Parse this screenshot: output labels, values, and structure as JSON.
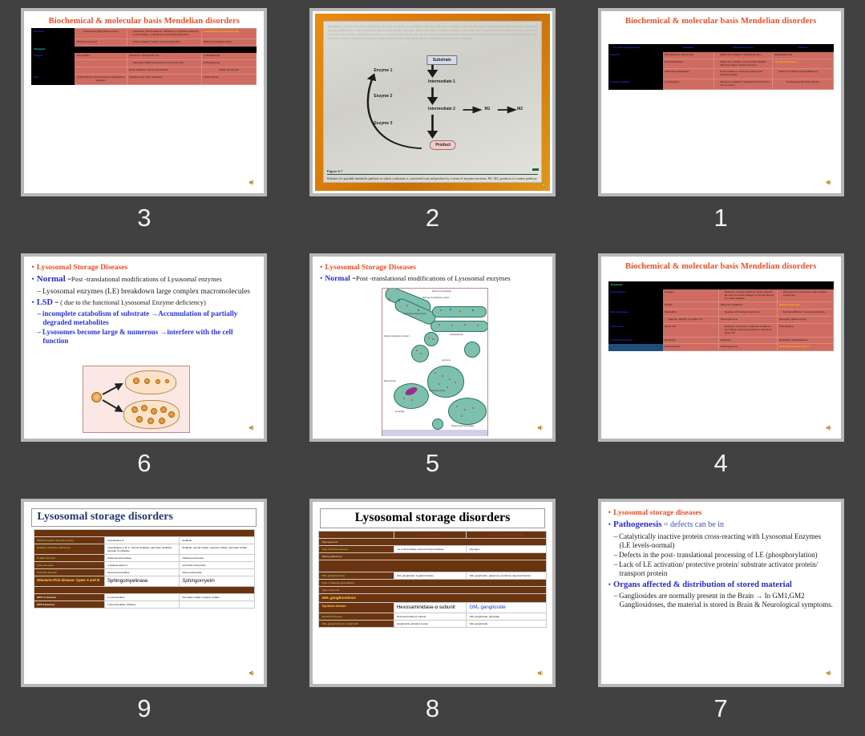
{
  "app": {
    "background_color": "#414141",
    "slide_border_color": "#b8b8b8",
    "layout": "3x3 slide thumbnail grid, numbered descending"
  },
  "slides": [
    {
      "number": "3",
      "title": "Biochemical & molecular basis Mendelian disorders",
      "type": "table",
      "table": {
        "rows": [
          {
            "kind": "data",
            "cells": [
              "Receptor",
              "Low-density lipoprotein receptor",
              "Deletions; point mutations: reduction of synthesis, transport to cell surface, or binding to low-density lipoprotein",
              "Familial hypercholesterolemia"
            ],
            "highlight_last": true
          },
          {
            "kind": "data",
            "cells": [
              "",
              "Vitamin D receptor",
              "Point mutations: failure of normal signaling",
              "Vitamin D-resistant rickets"
            ]
          },
          {
            "kind": "section",
            "cells": [
              "Transport"
            ]
          },
          {
            "kind": "data",
            "cells": [
              "Oxygen",
              "Hemoglobin",
              "Deletions: reduced amount",
              "α-Thalassemia"
            ]
          },
          {
            "kind": "data",
            "cells": [
              "",
              "",
              "Defective mRNA processing: reduced amount",
              "β-Thalassemia"
            ]
          },
          {
            "kind": "data",
            "cells": [
              "",
              "",
              "Point mutations: abnormal structure",
              "Sickle cell anemia"
            ]
          },
          {
            "kind": "data",
            "cells": [
              "Ions",
              "Cystic fibrosis transmembrane conductance regulator",
              "Deletions and other mutations",
              "Cystic fibrosis"
            ]
          }
        ]
      }
    },
    {
      "number": "2",
      "title": "",
      "type": "figure",
      "figure": {
        "nodes": [
          "Substrate",
          "Intermediate 1",
          "Intermediate 2",
          "Product",
          "M1",
          "M2"
        ],
        "enzymes": [
          "Enzyme 1",
          "Enzyme 2",
          "Enzyme 3"
        ],
        "figure_label": "Figure 6-7",
        "caption": "Scheme of a possible metabolic pathway in which a substrate is converted to an end product by a series of enzyme reactions. M1, M2, products of a minor pathway.",
        "ghost_text": "Biochemical and Molecular Basis of Mendelian disorders. As alluded to in Chapter 4, Decline in the rate of synthesis of mitochondria found in the metabolic mechanism may result in an abnormal malfunction or which a metabolic protein functions quite differently, which only results on being so transport as the body; they catalyze many cell transfer products at the tertiary lipoprotein, and protein compounds for transport of an enzyme. Because the large shows enzyme and structural genetic models of the Mendelian syndromes in these disease categories; the biochemical source to illustrate the general principles described above, methods developed for evaluating of the ribosome formation."
      }
    },
    {
      "number": "1",
      "title": "Biochemical & molecular basis Mendelian disorders",
      "type": "table",
      "table": {
        "headers": [
          "Protein Type/Function",
          "Example",
          "Molecular Lesion",
          "Disease"
        ],
        "rows": [
          {
            "kind": "data",
            "cells": [
              "Enzyme",
              "Phenylalanine hydroxylase",
              "Splice site mutation: reduced amount",
              "Phenylketonuria"
            ]
          },
          {
            "kind": "data",
            "cells": [
              "",
              "Hexosaminidase",
              "Splice site mutation or frameshift mutation with stop codon: reduced amount",
              "Tay-Sachs disease"
            ],
            "highlight_last": true
          },
          {
            "kind": "data",
            "cells": [
              "",
              "Adenosine deaminase",
              "Point mutations: abnormal protein with reduced activity",
              "Severe combined immunodeficiency"
            ]
          },
          {
            "kind": "data",
            "cells": [
              "Enzyme inhibitor",
              "α₁-Antitrypsin",
              "Missense mutations: impaired secretion from liver to serum",
              "Emphysema and liver disease"
            ]
          }
        ]
      }
    },
    {
      "number": "6",
      "title": "Lysosomal Storage Diseases",
      "type": "bullets",
      "bullets": [
        {
          "level": 1,
          "text": "Lysosomal Storage Diseases",
          "style": "red-title"
        },
        {
          "level": 1,
          "lead": "Normal",
          "text": "=Post -translational modifications of Lysosomal enzymes"
        },
        {
          "level": 2,
          "text": "Lysosomal enzymes (LE) breakdown large complex macromolecules"
        },
        {
          "level": 1,
          "lead": "LSD",
          "text": "= ( due to the functional Lysosomal Enzyme deficiency)"
        },
        {
          "level": 2,
          "text": "incomplete catabolism of substrate →Accumulation of partially degraded metabolites",
          "style": "blue-bold"
        },
        {
          "level": 2,
          "text": "Lysosomes become large & numerous →interfere with the cell function",
          "style": "blue-bold"
        }
      ],
      "inset_image": "lysosome-accumulation-diagram"
    },
    {
      "number": "5",
      "title": "Lysosomal Storage Diseases",
      "type": "bullets-with-figure",
      "bullets": [
        {
          "level": 1,
          "text": "Lysosomal Storage Diseases",
          "style": "red-title"
        },
        {
          "level": 1,
          "lead": "Normal",
          "text": "=Post -translational modifications of Lysosomal enzymes"
        }
      ],
      "figure_labels": [
        "Mannose-6-phosphate",
        "Mannose-6-phosphate receptor",
        "Lysosomal enzyme protein",
        "Rough endoplasmic reticulum",
        "Golgi apparatus",
        "Lysosome",
        "Mitochondrion",
        "Lysosomal enzyme",
        "Autophagy",
        "Phagocytosis heterophagy"
      ]
    },
    {
      "number": "4",
      "title": "Biochemical & molecular basis Mendelian disorders",
      "type": "table",
      "table": {
        "rows": [
          {
            "kind": "section",
            "cells": [
              "Structural"
            ]
          },
          {
            "kind": "data",
            "cells": [
              "Extracellular",
              "Collagen",
              "Deletions or point mutations cause reduced amount of normal collagen or normal amount of mutant collagen",
              "Osteogenesis imperfecta; Ehlers-Danlos syndromes"
            ]
          },
          {
            "kind": "data",
            "cells": [
              "",
              "Fibrillin",
              "Missense mutations",
              "Marfan syndrome"
            ],
            "highlight_last": true
          },
          {
            "kind": "data",
            "cells": [
              "Cell membrane",
              "Dystrophin",
              "Deletion with reduced synthesis",
              "Duchenne/Becker muscular dystrophy"
            ]
          },
          {
            "kind": "data",
            "cells": [
              "",
              "Spectrin, ankyrin, or protein 4.1",
              "Heterogeneous",
              "Hereditary spherocytosis"
            ]
          },
          {
            "kind": "data",
            "cells": [
              "Hemostasis",
              "Factor VIII",
              "Deletions, insertions, nonsense mutations, and others: reduced synthesis or abnormal factor VIII",
              "Hemophilia A"
            ]
          },
          {
            "kind": "data",
            "cells": [
              "Growth Regulation",
              "Rb protein",
              "Deletions",
              "Hereditary retinoblastoma"
            ]
          },
          {
            "kind": "data",
            "cells": [
              "",
              "Neurofibromin",
              "Heterogeneous",
              "Neurofibromatosis type 1"
            ],
            "highlight_last": true,
            "key_blue_bg": true
          }
        ]
      }
    },
    {
      "number": "9",
      "title": "Lysosomal storage disorders",
      "type": "brown-table",
      "table": {
        "rows": [
          {
            "kind": "section",
            "cells": [
              "Sulfatidoses"
            ]
          },
          {
            "kind": "data",
            "cells": [
              "Metachromatic leukodystrophy",
              "Arylsulfatase A",
              "Sulfatide"
            ]
          },
          {
            "kind": "data",
            "cells": [
              "Multiple sulfatase deficiency",
              "Arylsulfatase A, B, C; steroid sulfatase; iduronate sulfatase; heparan N-sulfatase",
              "Sulfatide, steroid sulfate, heparan sulfate, dermatan sulfate"
            ]
          },
          {
            "kind": "data",
            "cells": [
              "Krabbe disease",
              "Galactocerebrosidase",
              "Galactocerebroside"
            ]
          },
          {
            "kind": "data",
            "cells": [
              "Fabry disease",
              "α-Galactosidase A",
              "Ceramide trihexoside"
            ]
          },
          {
            "kind": "data",
            "cells": [
              "Gaucher disease",
              "Glucocerebrosidase",
              "Glucocerebroside"
            ]
          },
          {
            "kind": "data",
            "cells": [
              "Niemann-Pick disease: types A and B",
              "Sphingomyelinase",
              "Sphingomyelin"
            ],
            "emphasis": true
          },
          {
            "kind": "section",
            "cells": [
              "Mucopolysaccharidoses (MPS)"
            ]
          },
          {
            "kind": "data",
            "cells": [
              "MPS I H (Hurler)",
              "α-L-Iduronidase",
              "Dermatan sulfate, heparan sulfate"
            ]
          },
          {
            "kind": "data",
            "cells": [
              "MPS II (Hunter)",
              "L-Iduronosulfate sulfatase",
              ""
            ]
          }
        ]
      }
    },
    {
      "number": "8",
      "title": "Lysosomal storage disorders",
      "type": "brown-table",
      "table": {
        "headers": [
          "Disease",
          "Enzyme Deficiency",
          "Major Accumulating Metabolites"
        ],
        "rows": [
          {
            "kind": "section",
            "cells": [
              "Glycogenosis"
            ]
          },
          {
            "kind": "data",
            "cells": [
              "Type 2-Pompe disease",
              "α-1,4-Glucosidase (lysosomal glucosidase)",
              "Glycogen"
            ]
          },
          {
            "kind": "section",
            "cells": [
              "Sphingolipidoses"
            ]
          },
          {
            "kind": "blank",
            "cells": [
              ""
            ]
          },
          {
            "kind": "data",
            "cells": [
              "GM₁ gangliosidosis",
              "GM₁ ganglioside: β-galactosidase",
              "GM₁ ganglioside, galactose-containing oligosaccharides"
            ]
          },
          {
            "kind": "section",
            "cells": [
              "Type 1 infantile generalized"
            ]
          },
          {
            "kind": "section",
            "cells": [
              "Type 2 juvenile"
            ]
          },
          {
            "kind": "section-yellow",
            "cells": [
              "GM₂ gangliosidosis"
            ]
          },
          {
            "kind": "data",
            "cells": [
              "Tay-Sachs disease",
              "Hexosaminidase-α subunit",
              "GM₂ ganglioside"
            ],
            "emphasis": true
          },
          {
            "kind": "data",
            "cells": [
              "Sandhoff disease",
              "Hexosaminidase β subunit",
              "GM₂ ganglioside, globoside"
            ]
          },
          {
            "kind": "data",
            "cells": [
              "GM₂ gangliosidosis variant AB",
              "Ganglioside activator protein",
              "GM₂ ganglioside"
            ]
          }
        ]
      }
    },
    {
      "number": "7",
      "title": "Lysosomal storage diseases",
      "type": "bullets",
      "bullets": [
        {
          "level": 1,
          "text": "Lysosomal storage diseases",
          "style": "red-title"
        },
        {
          "level": 1,
          "lead": "Pathogenesis",
          "text": "= defects can be in"
        },
        {
          "level": 2,
          "text": "Catalytically inactive protein cross-reacting with Lysosomal Enzymes (LE levels-normal)"
        },
        {
          "level": 2,
          "text": "Defects in the post- translational processing of LE (phosphorylation)"
        },
        {
          "level": 2,
          "text": "Lack of LE activation/ protective protein/ substrate activator protein/ transport protein"
        },
        {
          "level": 1,
          "text": "Organs affected & distribution of stored material",
          "style": "blue-bold"
        },
        {
          "level": 2,
          "text": "Gangliosides are normally present in the Brain → In GM1,GM2 Gangliosidoses, the material is stored in Brain & Neurological symptoms."
        }
      ]
    }
  ],
  "icons": {
    "speaker": "speaker-icon"
  }
}
